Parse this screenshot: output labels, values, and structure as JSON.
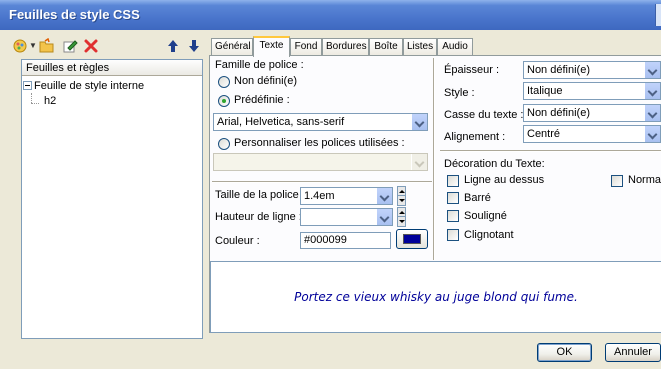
{
  "window": {
    "title": "Feuilles de style CSS"
  },
  "toolbar": {
    "icons": [
      "add-style-icon",
      "dropdown-caret-icon",
      "open-folder-icon",
      "edit-icon",
      "delete-icon",
      "move-up-icon",
      "move-down-icon"
    ]
  },
  "tree": {
    "header": "Feuilles et règles",
    "items": [
      {
        "label": "Feuille de style interne"
      },
      {
        "label": "h2"
      }
    ]
  },
  "tabs": [
    "Général",
    "Texte",
    "Fond",
    "Bordures",
    "Boîte",
    "Listes",
    "Audio"
  ],
  "active_tab": "Texte",
  "font": {
    "family_label": "Famille de police :",
    "undefined_label": "Non défini(e)",
    "predefined_label": "Prédéfinie :",
    "predefined_value": "Arial, Helvetica, sans-serif",
    "custom_label": "Personnaliser les polices utilisées :",
    "custom_value": "",
    "size_label": "Taille de la police :",
    "size_value": "1.4em",
    "line_height_label": "Hauteur de ligne :",
    "line_height_value": "",
    "color_label": "Couleur :",
    "color_value": "#000099",
    "color_swatch": "#000099"
  },
  "style": {
    "weight_label": "Épaisseur :",
    "weight_value": "Non défini(e)",
    "style_label": "Style :",
    "style_value": "Italique",
    "case_label": "Casse du texte :",
    "case_value": "Non défini(e)",
    "align_label": "Alignement :",
    "align_value": "Centré"
  },
  "decoration": {
    "title": "Décoration du Texte:",
    "overline": "Ligne au dessus",
    "normal": "Normal",
    "strikethrough": "Barré",
    "underline": "Souligné",
    "blink": "Clignotant"
  },
  "preview": {
    "text": "Portez ce vieux whisky au juge blond qui fume.",
    "color": "#000099"
  },
  "buttons": {
    "ok": "OK",
    "cancel": "Annuler"
  },
  "colors": {
    "titlebar": "#3e68c0",
    "accent_tab": "#ffc83c",
    "window_bg": "#ece9d8"
  }
}
